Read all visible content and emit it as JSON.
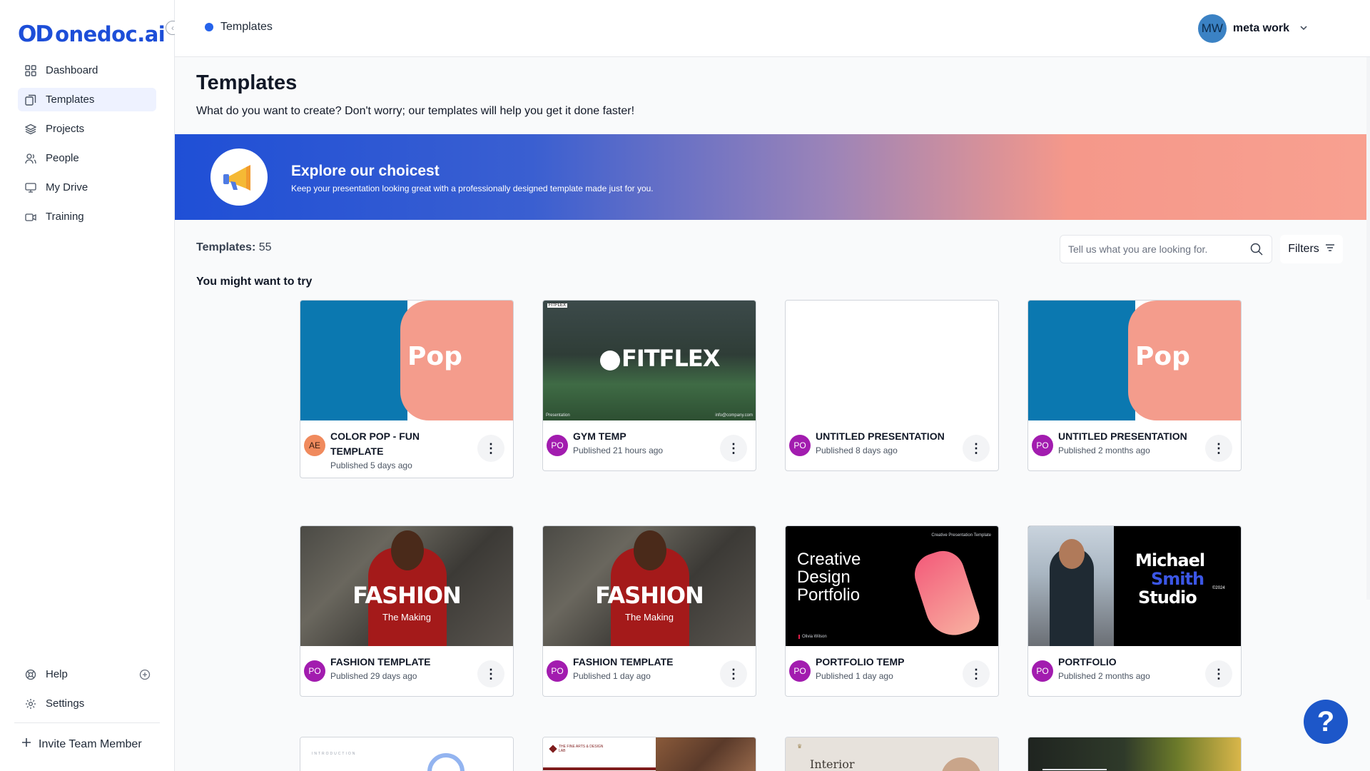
{
  "brand": {
    "mark": "OD",
    "name": "onedoc.ai"
  },
  "sidebar": {
    "items": [
      {
        "label": "Dashboard",
        "icon": "dashboard-icon"
      },
      {
        "label": "Templates",
        "icon": "templates-icon",
        "active": true
      },
      {
        "label": "Projects",
        "icon": "layers-icon"
      },
      {
        "label": "People",
        "icon": "people-icon"
      },
      {
        "label": "My Drive",
        "icon": "drive-icon"
      },
      {
        "label": "Training",
        "icon": "video-icon"
      }
    ],
    "bottom": [
      {
        "label": "Help",
        "icon": "help-icon"
      },
      {
        "label": "Settings",
        "icon": "gear-icon"
      }
    ],
    "invite_label": "Invite Team Member"
  },
  "header": {
    "breadcrumb": "Templates",
    "user": {
      "initials": "MW",
      "name": "meta work"
    }
  },
  "page": {
    "title": "Templates",
    "subtitle": "What do you want to create? Don't worry; our templates will help you get it done faster!"
  },
  "banner": {
    "title": "Explore our choicest",
    "subtitle": "Keep your presentation looking great with a professionally designed template made just for you."
  },
  "templates": {
    "count_label": "Templates:",
    "count": "55",
    "search_placeholder": "Tell us what you are looking for.",
    "filters_label": "Filters",
    "section_title": "You might want to try"
  },
  "cards": [
    {
      "title": "COLOR POP - FUN TEMPLATE",
      "meta": "Published 5 days ago",
      "avatar": "AE",
      "avatar_color": "#f08a5d",
      "thumb_word": "Pop"
    },
    {
      "title": "GYM TEMP",
      "meta": "Published 21 hours ago",
      "avatar": "PO",
      "avatar_color": "#a21caf",
      "thumb_word": "FITFLEX",
      "thumb_small_top": "FITFLEX",
      "thumb_small_left": "Presentation",
      "thumb_small_right": "info@company.com"
    },
    {
      "title": "UNTITLED PRESENTATION",
      "meta": "Published 8 days ago",
      "avatar": "PO",
      "avatar_color": "#a21caf"
    },
    {
      "title": "UNTITLED PRESENTATION",
      "meta": "Published 2 months ago",
      "avatar": "PO",
      "avatar_color": "#a21caf",
      "thumb_word": "Pop"
    },
    {
      "title": "FASHION TEMPLATE",
      "meta": "Published 29 days ago",
      "avatar": "PO",
      "avatar_color": "#a21caf",
      "thumb_word": "FASHION",
      "thumb_sub": "The Making"
    },
    {
      "title": "FASHION TEMPLATE",
      "meta": "Published 1 day ago",
      "avatar": "PO",
      "avatar_color": "#a21caf",
      "thumb_word": "FASHION",
      "thumb_sub": "The Making"
    },
    {
      "title": "PORTFOLIO TEMP",
      "meta": "Published 1 day ago",
      "avatar": "PO",
      "avatar_color": "#a21caf",
      "thumb_lines": [
        "Creative",
        "Design",
        "Portfolio"
      ],
      "thumb_small_top": "Creative Presentation Template",
      "thumb_small_left": "Olivia Wilson"
    },
    {
      "title": "PORTFOLIO",
      "meta": "Published 2 months ago",
      "avatar": "PO",
      "avatar_color": "#a21caf",
      "thumb_lines": [
        "Michael",
        "Smith",
        "Studio"
      ],
      "thumb_year": "©2024"
    }
  ],
  "row3": [
    {
      "thumb_text": "INTRODUCTION"
    },
    {
      "thumb_text": "THE FINE ARTS & DESIGN LAB"
    },
    {
      "thumb_text": "Interior"
    },
    {
      "thumb_text": ""
    }
  ],
  "help_fab": "?",
  "colors": {
    "accent": "#2563eb",
    "banner_start": "#1f4fd6",
    "banner_end": "#f8a090",
    "pop_blue": "#0b78b0",
    "pop_pink": "#f49c8c"
  }
}
